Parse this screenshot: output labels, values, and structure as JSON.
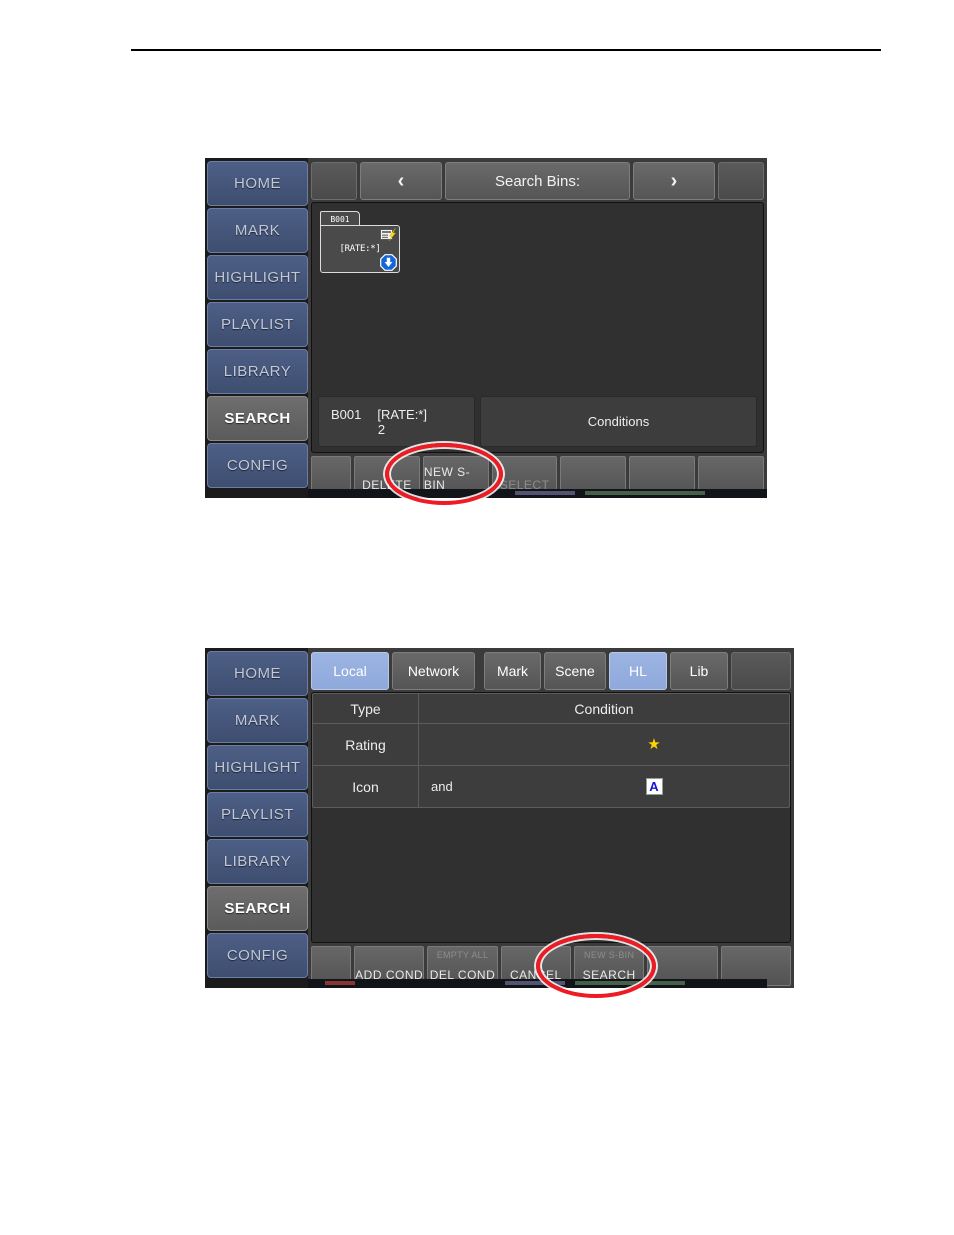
{
  "sidebar": {
    "items": [
      {
        "label": "HOME",
        "active": false
      },
      {
        "label": "MARK",
        "active": false
      },
      {
        "label": "HIGHLIGHT",
        "active": false
      },
      {
        "label": "PLAYLIST",
        "active": false
      },
      {
        "label": "LIBRARY",
        "active": false
      },
      {
        "label": "SEARCH",
        "active": true
      },
      {
        "label": "CONFIG",
        "active": false
      }
    ]
  },
  "panel1": {
    "topbar": {
      "prev_label": "‹",
      "title": "Search Bins:",
      "next_label": "›"
    },
    "bin": {
      "tab_label": "B001",
      "body_label": "[RATE:*]",
      "edit_icon": "edit-list-icon",
      "status_icon": "blue-down-arrow-icon"
    },
    "info": {
      "bin_name": "B001",
      "bin_condition": "[RATE:*]",
      "bin_count": "2",
      "conditions_label": "Conditions"
    },
    "toolbar": [
      {
        "sub": "",
        "label": "",
        "dim": false
      },
      {
        "sub": "",
        "label": "DELETE",
        "dim": false
      },
      {
        "sub": "",
        "label": "NEW S-BIN",
        "dim": false
      },
      {
        "sub": "",
        "label": "SELECT",
        "dim": true
      },
      {
        "sub": "",
        "label": "",
        "dim": false
      },
      {
        "sub": "",
        "label": "",
        "dim": false
      },
      {
        "sub": "",
        "label": "",
        "dim": false
      }
    ]
  },
  "panel2": {
    "tabs": [
      {
        "label": "Local",
        "selected": true
      },
      {
        "label": "Network",
        "selected": false
      },
      {
        "label": "Mark",
        "selected": false
      },
      {
        "label": "Scene",
        "selected": false
      },
      {
        "label": "HL",
        "selected": true
      },
      {
        "label": "Lib",
        "selected": false
      }
    ],
    "table": {
      "headers": [
        "Type",
        "Condition"
      ],
      "rows": [
        {
          "type": "Rating",
          "operator": "",
          "value_icon": "yellow-star-icon",
          "value_glyph": "★"
        },
        {
          "type": "Icon",
          "operator": "and",
          "value_icon": "blue-letter-a-icon",
          "value_glyph": "A"
        }
      ]
    },
    "toolbar": [
      {
        "sub": "",
        "label": "",
        "dim": false
      },
      {
        "sub": "",
        "label": "ADD COND",
        "dim": false
      },
      {
        "sub": "EMPTY ALL",
        "label": "DEL COND",
        "dim": false
      },
      {
        "sub": "",
        "label": "CANCEL",
        "dim": false
      },
      {
        "sub": "NEW S-BIN",
        "label": "SEARCH",
        "dim": false
      },
      {
        "sub": "",
        "label": "",
        "dim": false
      },
      {
        "sub": "",
        "label": "",
        "dim": false
      }
    ]
  },
  "annotations": {
    "ellipse1_target": "NEW S-BIN",
    "ellipse2_target": "SEARCH"
  },
  "colors": {
    "accent_blue": "#8fa9dc",
    "sidebar_blue": "#4d5f86",
    "annotation_red": "#ee1b24",
    "star_yellow": "#ffd400",
    "panel_bg": "#3b3b3b"
  }
}
